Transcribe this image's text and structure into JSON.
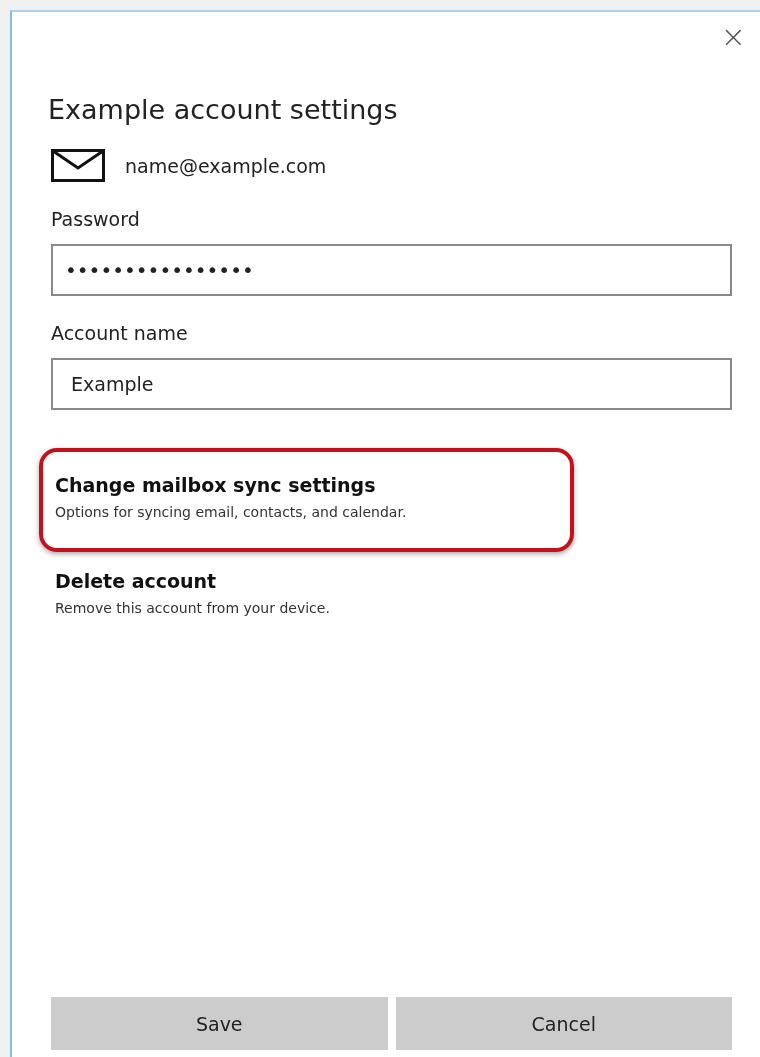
{
  "dialog": {
    "close": "×",
    "title": "Example account settings",
    "email": "name@example.com"
  },
  "fields": [
    {
      "label": "Password",
      "value": "••••••••••••••••",
      "kind": "password"
    },
    {
      "label": "Account name",
      "value": "Example",
      "kind": "text"
    }
  ],
  "options": [
    {
      "title": "Change mailbox sync settings",
      "description": "Options for syncing email, contacts, and calendar.",
      "highlighted": true
    },
    {
      "title": "Delete account",
      "description": "Remove this account from your device.",
      "highlighted": false
    }
  ],
  "buttons": [
    "Save",
    "Cancel"
  ]
}
